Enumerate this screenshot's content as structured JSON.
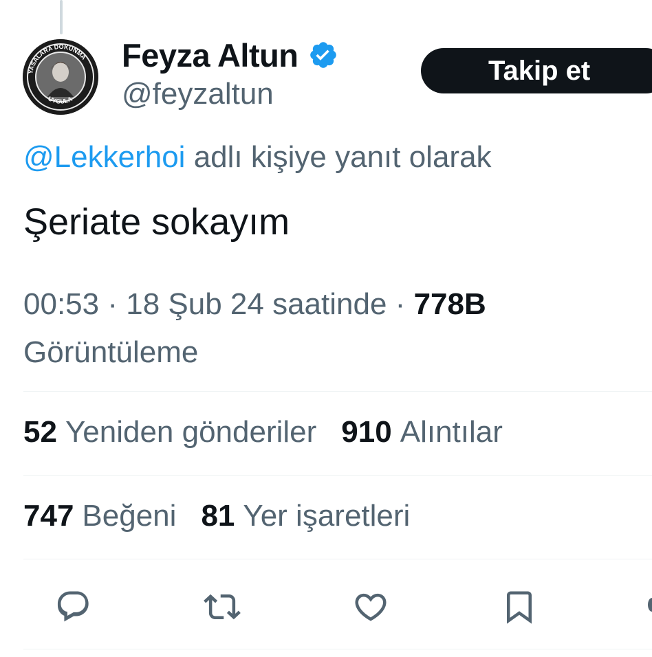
{
  "author": {
    "display_name": "Feyza Altun",
    "handle": "@feyzaltun",
    "verified_icon": "verified-badge-icon",
    "avatar_text_top": "YASALARA DOKUNMA",
    "avatar_text_bottom": "UYGULA"
  },
  "follow_button": {
    "label": "Takip et"
  },
  "reply_context": {
    "mention": "@Lekkerhoi",
    "suffix": "adlı kişiye yanıt olarak"
  },
  "tweet": {
    "text": "Şeriate sokayım",
    "time": "00:53",
    "date": "18 Şub 24 saatinde",
    "separator": "·",
    "views_count": "778B",
    "views_label": "Görüntüleme"
  },
  "stats": {
    "retweets_count": "52",
    "retweets_label": "Yeniden gönderiler",
    "quotes_count": "910",
    "quotes_label": "Alıntılar",
    "likes_count": "747",
    "likes_label": "Beğeni",
    "bookmarks_count": "81",
    "bookmarks_label": "Yer işaretleri"
  },
  "actions": [
    "reply-icon",
    "retweet-icon",
    "like-icon",
    "bookmark-icon"
  ],
  "colors": {
    "accent": "#1d9bf0",
    "text": "#0f1419",
    "secondary": "#536471",
    "divider": "#eff3f4",
    "button": "#0f1419"
  }
}
